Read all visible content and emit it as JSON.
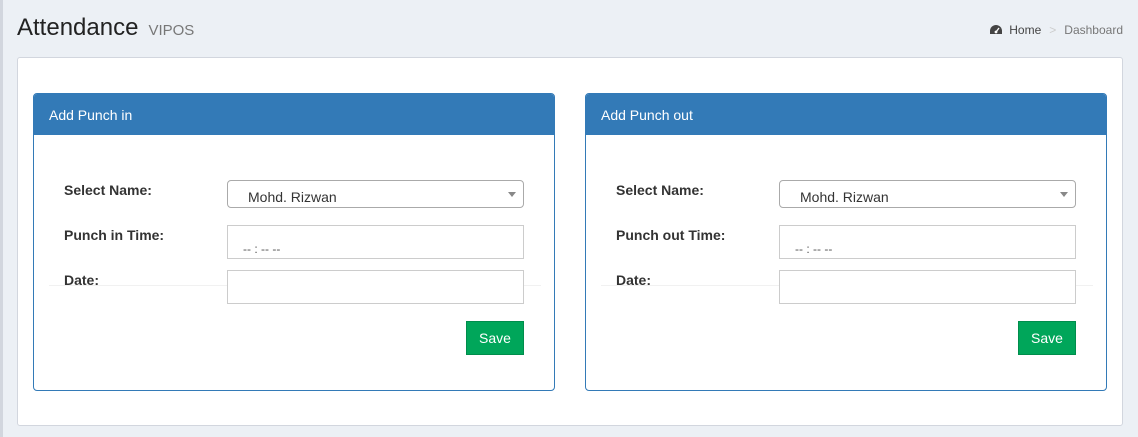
{
  "header": {
    "title": "Attendance",
    "subtitle": "VIPOS"
  },
  "breadcrumb": {
    "icon": "dashboard-icon",
    "home": "Home",
    "separator": ">",
    "current": "Dashboard"
  },
  "punch_in": {
    "heading": "Add Punch in",
    "name_label": "Select Name:",
    "name_value": "Mohd. Rizwan",
    "time_label": "Punch in Time:",
    "time_value": "-- : --   --",
    "date_label": "Date:",
    "date_value": "",
    "save_label": "Save"
  },
  "punch_out": {
    "heading": "Add Punch out",
    "name_label": "Select Name:",
    "name_value": "Mohd. Rizwan",
    "time_label": "Punch out Time:",
    "time_value": "-- : --   --",
    "date_label": "Date:",
    "date_value": "",
    "save_label": "Save"
  },
  "colors": {
    "panel_primary": "#337ab7",
    "save_button": "#00a65a",
    "background": "#ecf0f5"
  }
}
